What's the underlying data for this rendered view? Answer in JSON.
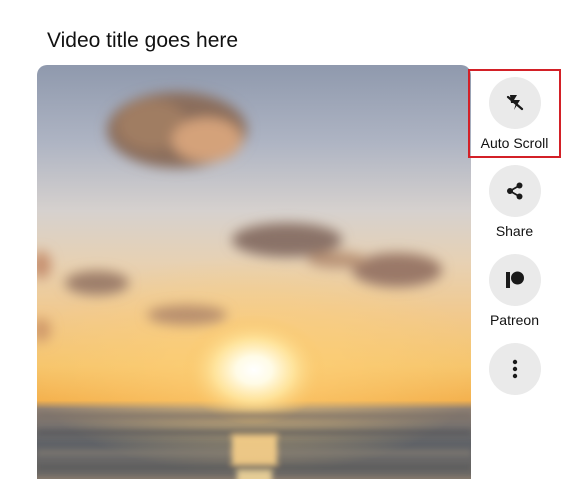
{
  "video": {
    "title": "Video title goes here"
  },
  "actions": {
    "autoscroll": {
      "label": "Auto Scroll",
      "icon": "auto-scroll-icon",
      "highlighted": true,
      "highlight_color": "#d32027"
    },
    "share": {
      "label": "Share",
      "icon": "share-icon"
    },
    "patreon": {
      "label": "Patreon",
      "icon": "patreon-icon"
    },
    "more": {
      "label": "",
      "icon": "more-vertical-icon"
    }
  },
  "colors": {
    "button_bg": "#eaeaea",
    "icon": "#1a1a1a",
    "text": "#111111"
  }
}
